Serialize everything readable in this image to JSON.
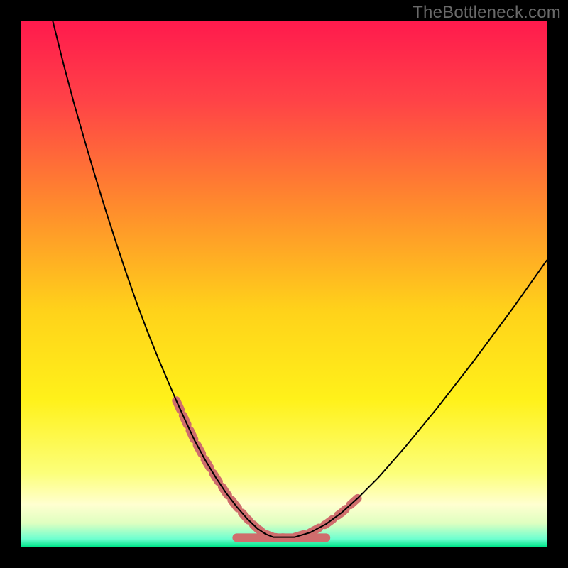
{
  "watermark": "TheBottleneck.com",
  "chart_data": {
    "type": "line",
    "title": "",
    "xlabel": "",
    "ylabel": "",
    "xlim": [
      0,
      100
    ],
    "ylim": [
      0,
      100
    ],
    "grid": false,
    "legend": false,
    "background_gradient_stops": [
      {
        "offset": 0.0,
        "color": "#ff1a4d"
      },
      {
        "offset": 0.15,
        "color": "#ff4247"
      },
      {
        "offset": 0.35,
        "color": "#ff8a2d"
      },
      {
        "offset": 0.55,
        "color": "#ffd21a"
      },
      {
        "offset": 0.72,
        "color": "#fff11a"
      },
      {
        "offset": 0.86,
        "color": "#fcff7a"
      },
      {
        "offset": 0.92,
        "color": "#ffffd0"
      },
      {
        "offset": 0.955,
        "color": "#dfffc0"
      },
      {
        "offset": 0.985,
        "color": "#6fffd0"
      },
      {
        "offset": 1.0,
        "color": "#00e58a"
      }
    ],
    "series": [
      {
        "name": "bottleneck-curve",
        "stroke": "#000000",
        "stroke_width": 2,
        "x": [
          6,
          8,
          10,
          12,
          14,
          16,
          18,
          20,
          22,
          24,
          26,
          28,
          29.5,
          31,
          33,
          35,
          37,
          39,
          41,
          43,
          45,
          46.5,
          48,
          52,
          55,
          58,
          61,
          64,
          68,
          73,
          79,
          86,
          94,
          100
        ],
        "y": [
          100,
          92,
          84.5,
          77.5,
          70.7,
          64.2,
          58,
          52,
          46.3,
          41,
          36,
          31.3,
          27.8,
          24.5,
          20.2,
          16.5,
          13.2,
          10.2,
          7.6,
          5.3,
          3.4,
          2.4,
          1.8,
          1.8,
          2.7,
          4.3,
          6.5,
          9.2,
          13.2,
          18.9,
          26.2,
          35.2,
          46,
          54.5
        ]
      }
    ],
    "highlight_segments": {
      "name": "bottleneck-highlight",
      "stroke": "#cf6d6d",
      "stroke_width": 12,
      "dash": "14 9",
      "segments": [
        {
          "x": [
            29.5,
            31,
            33,
            35,
            37,
            39,
            41,
            43,
            45,
            46.5,
            48,
            50
          ],
          "y": [
            27.8,
            24.5,
            20.2,
            16.5,
            13.2,
            10.2,
            7.6,
            5.3,
            3.4,
            2.4,
            1.8,
            1.7
          ]
        },
        {
          "x": [
            52,
            55,
            58,
            61,
            64
          ],
          "y": [
            1.8,
            2.7,
            4.3,
            6.5,
            9.2
          ]
        }
      ]
    },
    "flat_zone": {
      "name": "optimal-zone",
      "stroke": "#cf6d6d",
      "stroke_width": 12,
      "x": [
        41,
        58
      ],
      "y": [
        1.7,
        1.7
      ]
    }
  }
}
